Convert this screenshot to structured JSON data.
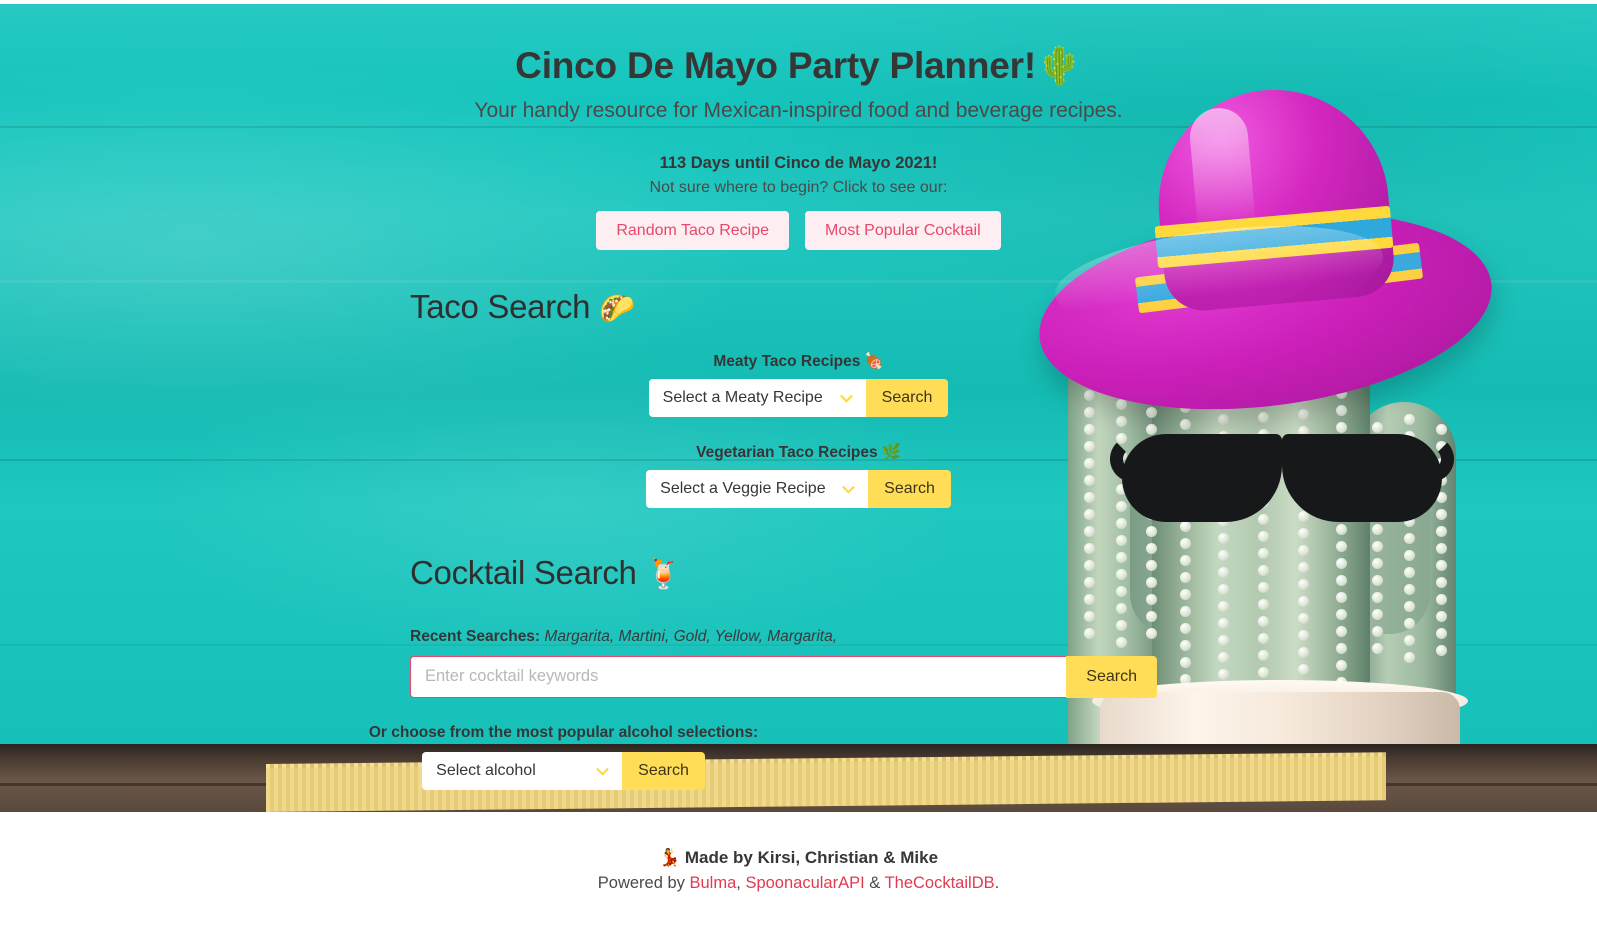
{
  "hero": {
    "title": "Cinco De Mayo Party Planner!",
    "title_emoji": "🌵",
    "subtitle": "Your handy resource for Mexican-inspired food and beverage recipes.",
    "countdown": "113 Days until Cinco de Mayo 2021!",
    "begin_prompt": "Not sure where to begin? Click to see our:",
    "quick_buttons": [
      {
        "label": "Random Taco Recipe"
      },
      {
        "label": "Most Popular Cocktail"
      }
    ]
  },
  "taco": {
    "heading": "Taco Search",
    "heading_emoji": "🌮",
    "meaty": {
      "label": "Meaty Taco Recipes",
      "emoji": "🍖",
      "select_value": "Select a Meaty Recipe",
      "search_label": "Search"
    },
    "veggie": {
      "label": "Vegetarian Taco Recipes",
      "emoji": "🌿",
      "select_value": "Select a Veggie Recipe",
      "search_label": "Search"
    }
  },
  "cocktail": {
    "heading": "Cocktail Search",
    "heading_emoji": "🍹",
    "recent_label": "Recent Searches:",
    "recent_values": "Margarita, Martini, Gold, Yellow, Margarita,",
    "input_placeholder": "Enter cocktail keywords",
    "input_value": "",
    "search_label": "Search",
    "alcohol_prompt": "Or choose from the most popular alcohol selections:",
    "alcohol_select_value": "Select alcohol",
    "alcohol_search_label": "Search"
  },
  "footer": {
    "made_by_emoji": "💃",
    "made_by": "Made by Kirsi, Christian & Mike",
    "powered_prefix": "Powered by ",
    "link_bulma": "Bulma",
    "sep1": ", ",
    "link_spoonacular": "SpoonacularAPI",
    "sep2": " & ",
    "link_cocktaildb": "TheCocktailDB",
    "period": "."
  },
  "colors": {
    "teal_background": "#15c5bd",
    "yellow_button": "#ffdd57",
    "pink_button_bg": "#fdeef1",
    "pink_text": "#e8486b",
    "link_red": "#e03b4f",
    "dark_text": "#363636"
  }
}
